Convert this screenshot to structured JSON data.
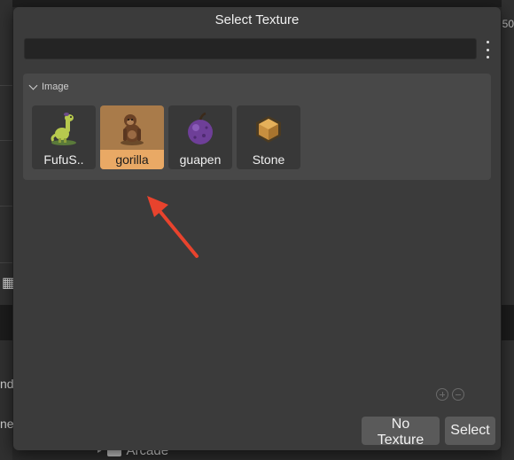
{
  "background": {
    "right_number": "50",
    "left_text_1": "nd-",
    "left_text_2": "ne",
    "tree_item": "Arcade"
  },
  "dialog": {
    "title": "Select Texture",
    "search": {
      "value": "",
      "placeholder": ""
    },
    "group": {
      "label": "Image",
      "items": [
        {
          "label": "FufuS..",
          "icon": "dinosaur-icon",
          "selected": false
        },
        {
          "label": "gorilla",
          "icon": "gorilla-icon",
          "selected": true
        },
        {
          "label": "guapen",
          "icon": "purple-fruit-icon",
          "selected": false
        },
        {
          "label": "Stone",
          "icon": "stone-block-icon",
          "selected": false
        }
      ]
    },
    "buttons": {
      "no_texture": "No Texture",
      "select": "Select"
    }
  },
  "colors": {
    "selected_tile": "#a97b4a",
    "selected_label": "#e9a965",
    "annotation_arrow": "#e8432d"
  }
}
